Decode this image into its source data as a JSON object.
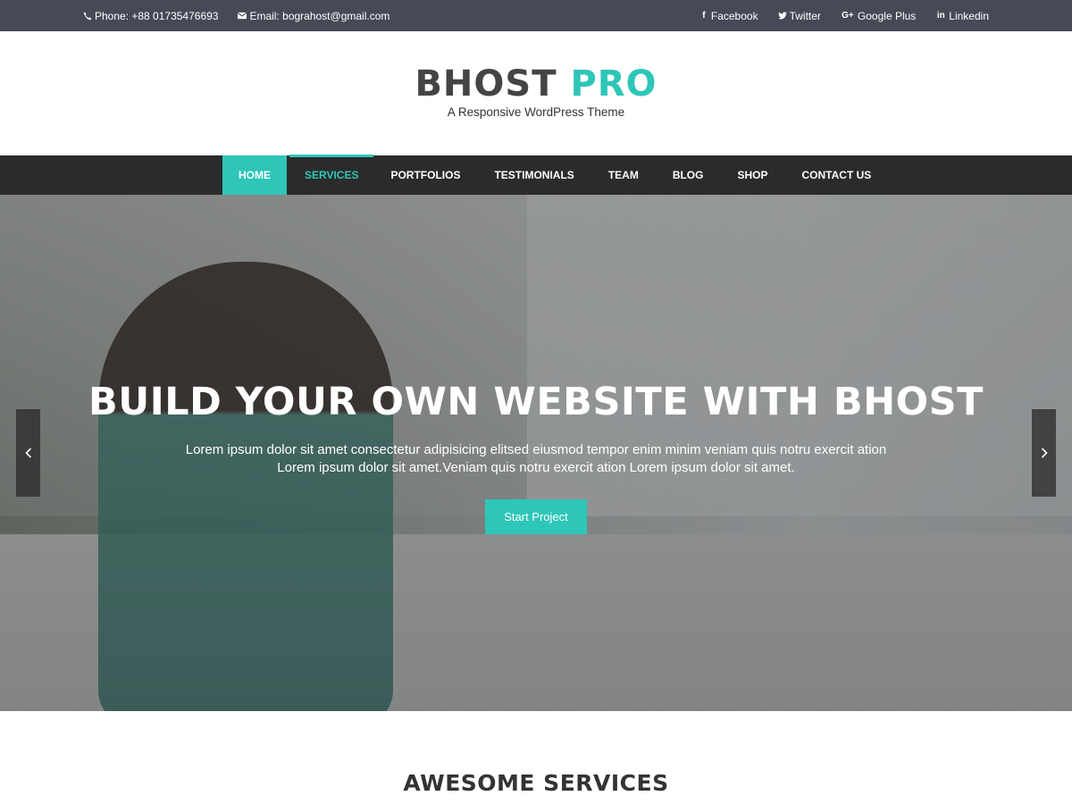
{
  "topbar": {
    "phone": "Phone: +88 01735476693",
    "email": "Email: bograhost@gmail.com",
    "social": [
      {
        "label": "Facebook",
        "icon": "facebook-icon"
      },
      {
        "label": "Twitter",
        "icon": "twitter-icon"
      },
      {
        "label": "Google Plus",
        "icon": "google-plus-icon"
      },
      {
        "label": "Linkedin",
        "icon": "linkedin-icon"
      }
    ]
  },
  "header": {
    "logo_part1": "BHOST",
    "logo_part2": "PRO",
    "tagline": "A Responsive WordPress Theme"
  },
  "nav": {
    "items": [
      "HOME",
      "SERVICES",
      "PORTFOLIOS",
      "TESTIMONIALS",
      "TEAM",
      "BLOG",
      "SHOP",
      "CONTACT US"
    ],
    "active": "HOME",
    "hover": "SERVICES"
  },
  "hero": {
    "title": "BUILD YOUR OWN WEBSITE WITH BHOST",
    "text_line1": "Lorem ipsum dolor sit amet consectetur adipisicing elitsed eiusmod tempor enim minim veniam quis notru exercit ation",
    "text_line2": "Lorem ipsum dolor sit amet.Veniam quis notru exercit ation Lorem ipsum dolor sit amet.",
    "button": "Start Project",
    "prev_icon": "chevron-left-icon",
    "next_icon": "chevron-right-icon"
  },
  "services": {
    "title": "AWESOME SERVICES"
  },
  "colors": {
    "accent": "#2ec6b8",
    "topbar_bg": "#454a56",
    "nav_bg": "#2b2b2b",
    "logo_dark": "#444444"
  }
}
